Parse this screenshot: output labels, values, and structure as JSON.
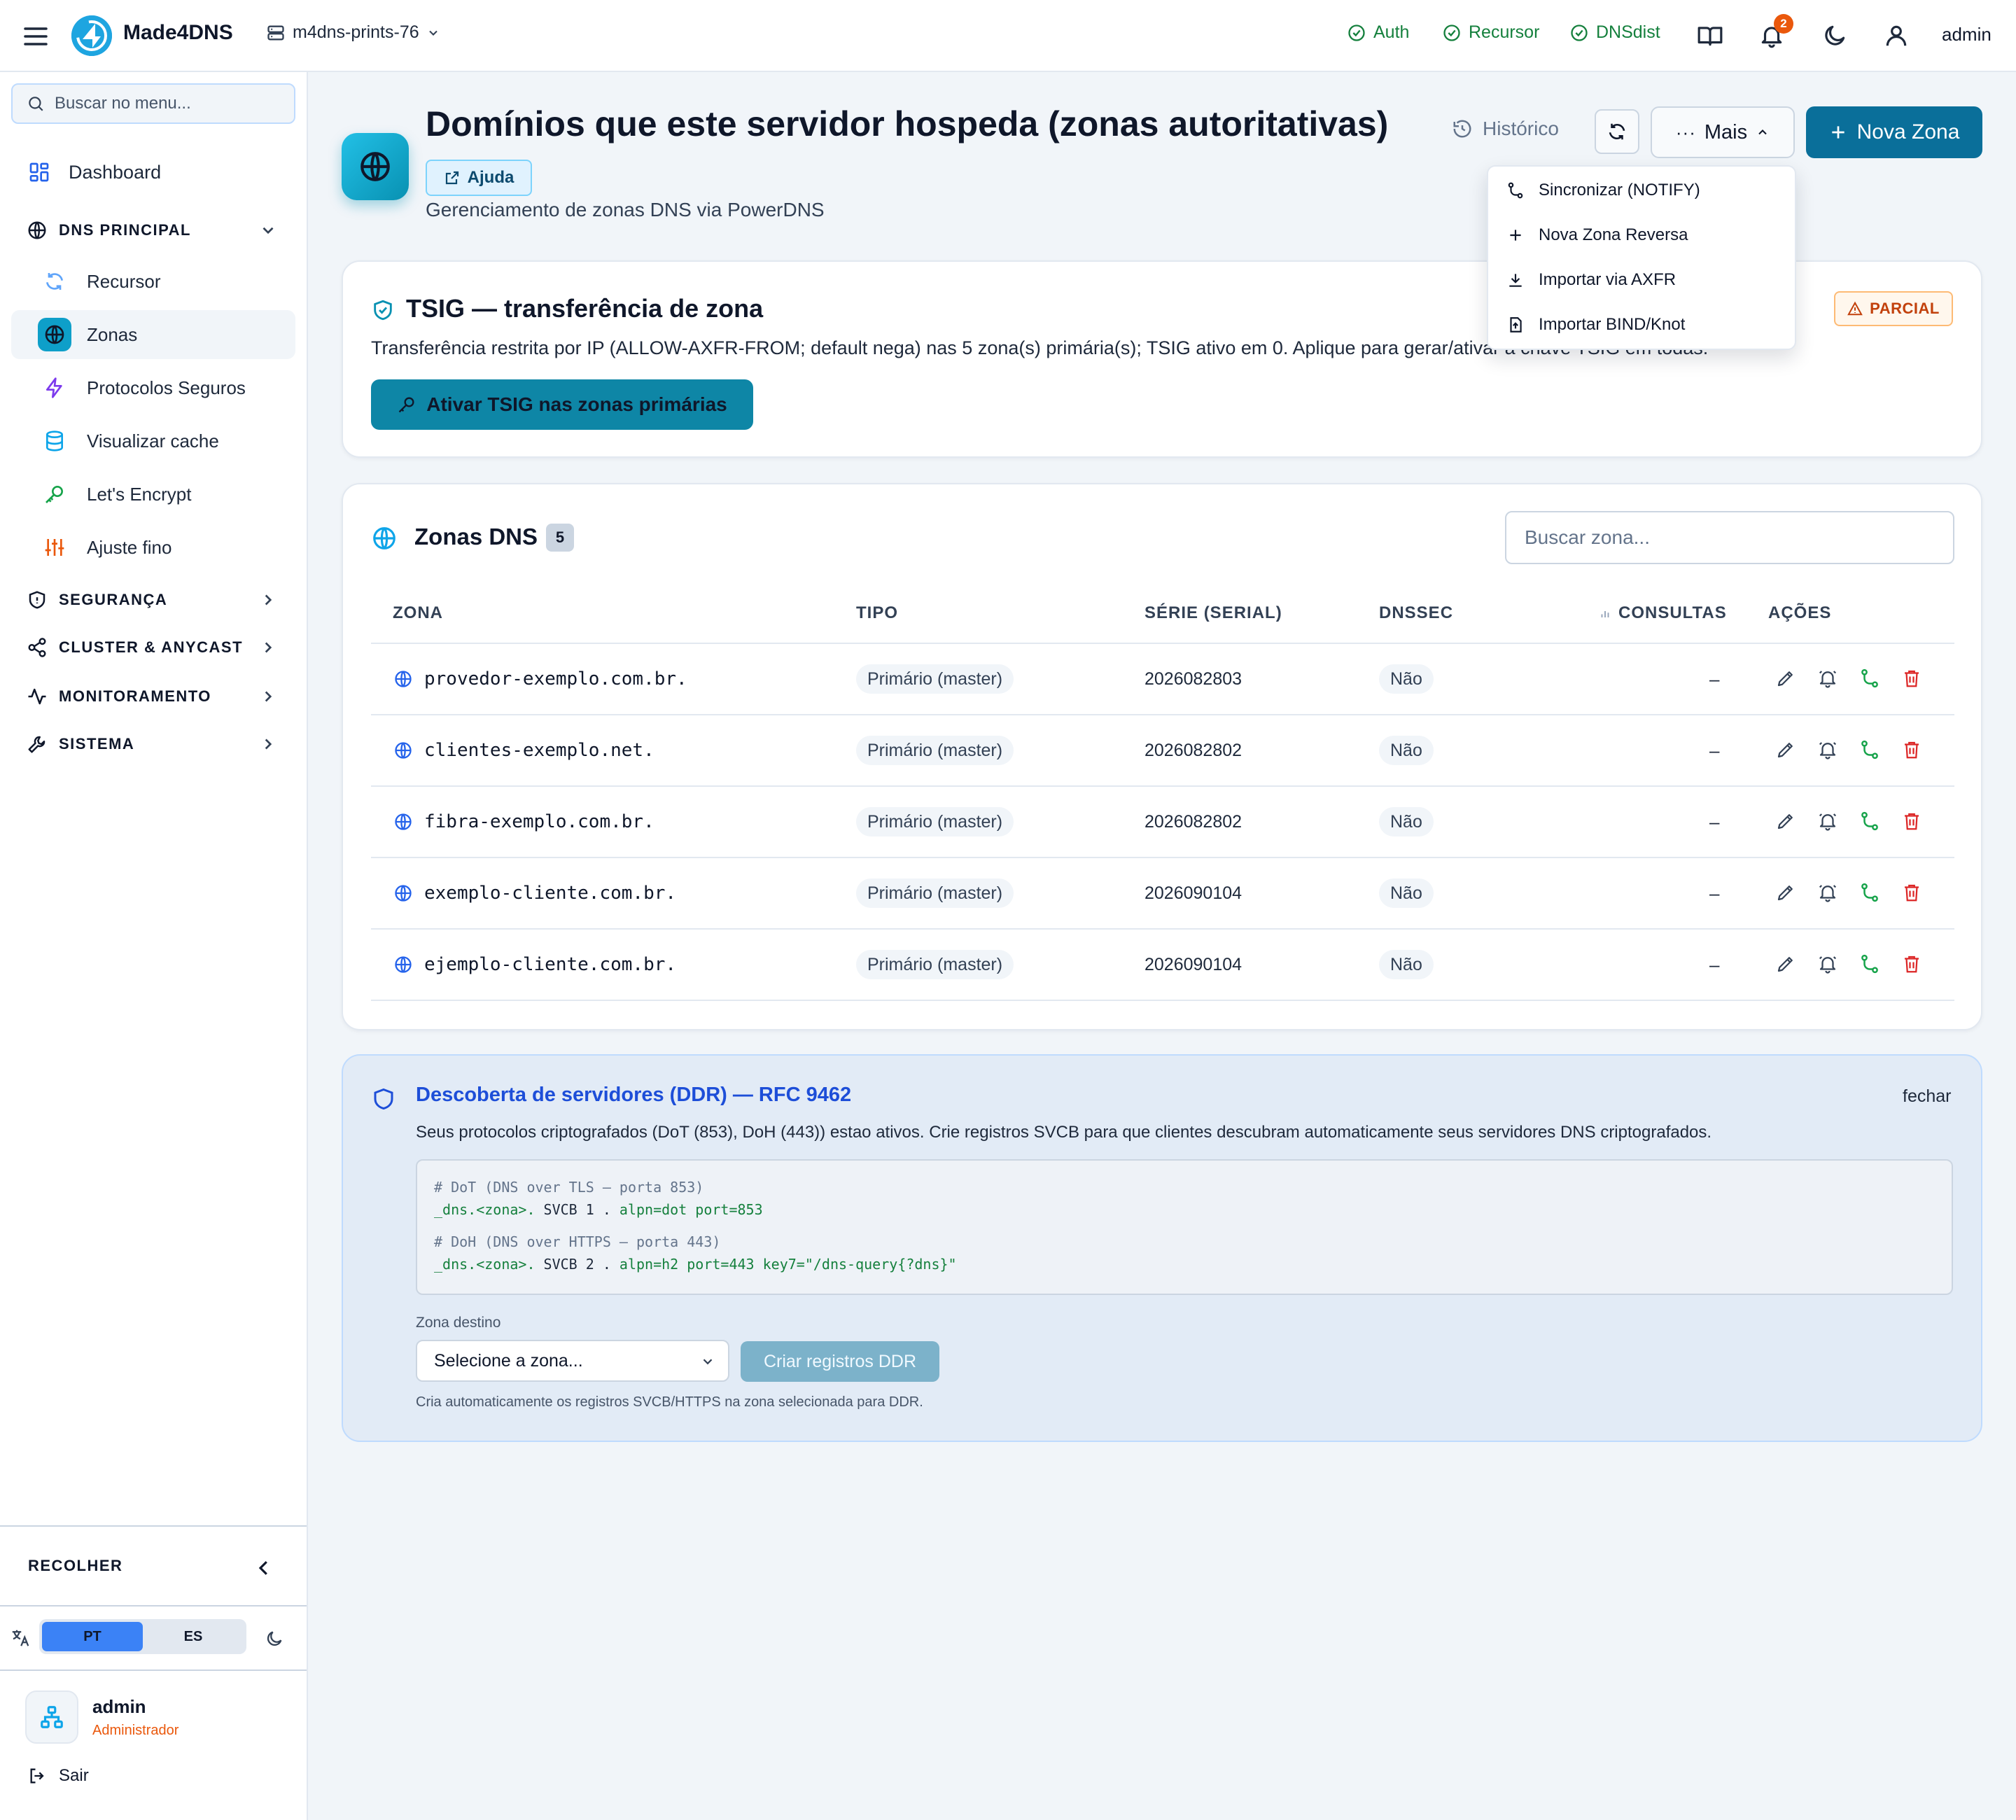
{
  "topbar": {
    "brand": "Made4DNS",
    "server": "m4dns-prints-76",
    "status": [
      {
        "label": "Auth",
        "color": "#15803d"
      },
      {
        "label": "Recursor",
        "color": "#15803d"
      },
      {
        "label": "DNSdist",
        "color": "#15803d"
      }
    ],
    "notification_count": "2",
    "user": "admin"
  },
  "sidebar": {
    "search_placeholder": "Buscar no menu...",
    "dashboard": "Dashboard",
    "dns_group": "DNS PRINCIPAL",
    "dns_items": [
      {
        "label": "Recursor",
        "icon": "refresh-icon"
      },
      {
        "label": "Zonas",
        "icon": "globe-icon"
      },
      {
        "label": "Protocolos Seguros",
        "icon": "zap-icon"
      },
      {
        "label": "Visualizar cache",
        "icon": "database-icon"
      },
      {
        "label": "Let's Encrypt",
        "icon": "key-icon"
      },
      {
        "label": "Ajuste fino",
        "icon": "sliders-icon"
      }
    ],
    "groups": [
      "SEGURANÇA",
      "CLUSTER & ANYCAST",
      "MONITORAMENTO",
      "SISTEMA"
    ],
    "collapse": "RECOLHER",
    "lang": [
      "PT",
      "ES"
    ],
    "user_name": "admin",
    "user_role": "Administrador",
    "logout": "Sair"
  },
  "header": {
    "title": "Domínios que este servidor hospeda (zonas autoritativas)",
    "help": "Ajuda",
    "subtitle": "Gerenciamento de zonas DNS via PowerDNS",
    "history": "Histórico",
    "more": "Mais",
    "new_zone": "Nova Zona"
  },
  "more_menu": [
    "Sincronizar (NOTIFY)",
    "Nova Zona Reversa",
    "Importar via AXFR",
    "Importar BIND/Knot"
  ],
  "tsig": {
    "title": "TSIG — transferência de zona",
    "status": "PARCIAL",
    "description": "Transferência restrita por IP (ALLOW-AXFR-FROM; default nega) nas 5 zona(s) primária(s); TSIG ativo em 0. Aplique para gerar/ativar a chave TSIG em todas.",
    "button": "Ativar TSIG nas zonas primárias"
  },
  "zones": {
    "title": "Zonas DNS",
    "count": "5",
    "search_placeholder": "Buscar zona...",
    "columns": [
      "ZONA",
      "TIPO",
      "SÉRIE (SERIAL)",
      "DNSSEC",
      "CONSULTAS",
      "AÇÕES"
    ],
    "rows": [
      {
        "zone": "provedor-exemplo.com.br.",
        "type": "Primário (master)",
        "serial": "2026082803",
        "dnssec": "Não",
        "queries": "–"
      },
      {
        "zone": "clientes-exemplo.net.",
        "type": "Primário (master)",
        "serial": "2026082802",
        "dnssec": "Não",
        "queries": "–"
      },
      {
        "zone": "fibra-exemplo.com.br.",
        "type": "Primário (master)",
        "serial": "2026082802",
        "dnssec": "Não",
        "queries": "–"
      },
      {
        "zone": "exemplo-cliente.com.br.",
        "type": "Primário (master)",
        "serial": "2026090104",
        "dnssec": "Não",
        "queries": "–"
      },
      {
        "zone": "ejemplo-cliente.com.br.",
        "type": "Primário (master)",
        "serial": "2026090104",
        "dnssec": "Não",
        "queries": "–"
      }
    ]
  },
  "ddr": {
    "title": "Descoberta de servidores (DDR) — RFC 9462",
    "close": "fechar",
    "description": "Seus protocolos criptografados (DoT (853), DoH (443)) estao ativos. Crie registros SVCB para que clientes descubram automaticamente seus servidores DNS criptografados.",
    "code": {
      "dot_comment": "# DoT (DNS over TLS — porta 853)",
      "dot_name": "_dns.<zona>.",
      "dot_type": " SVCB 1 . ",
      "dot_params": "alpn=dot port=853",
      "doh_comment": "# DoH (DNS over HTTPS — porta 443)",
      "doh_name": "_dns.<zona>.",
      "doh_type": " SVCB 2 . ",
      "doh_params": "alpn=h2 port=443 key7=\"/dns-query{?dns}\""
    },
    "zone_label": "Zona destino",
    "select_placeholder": "Selecione a zona...",
    "button": "Criar registros DDR",
    "hint": "Cria automaticamente os registros SVCB/HTTPS na zona selecionada para DDR."
  }
}
